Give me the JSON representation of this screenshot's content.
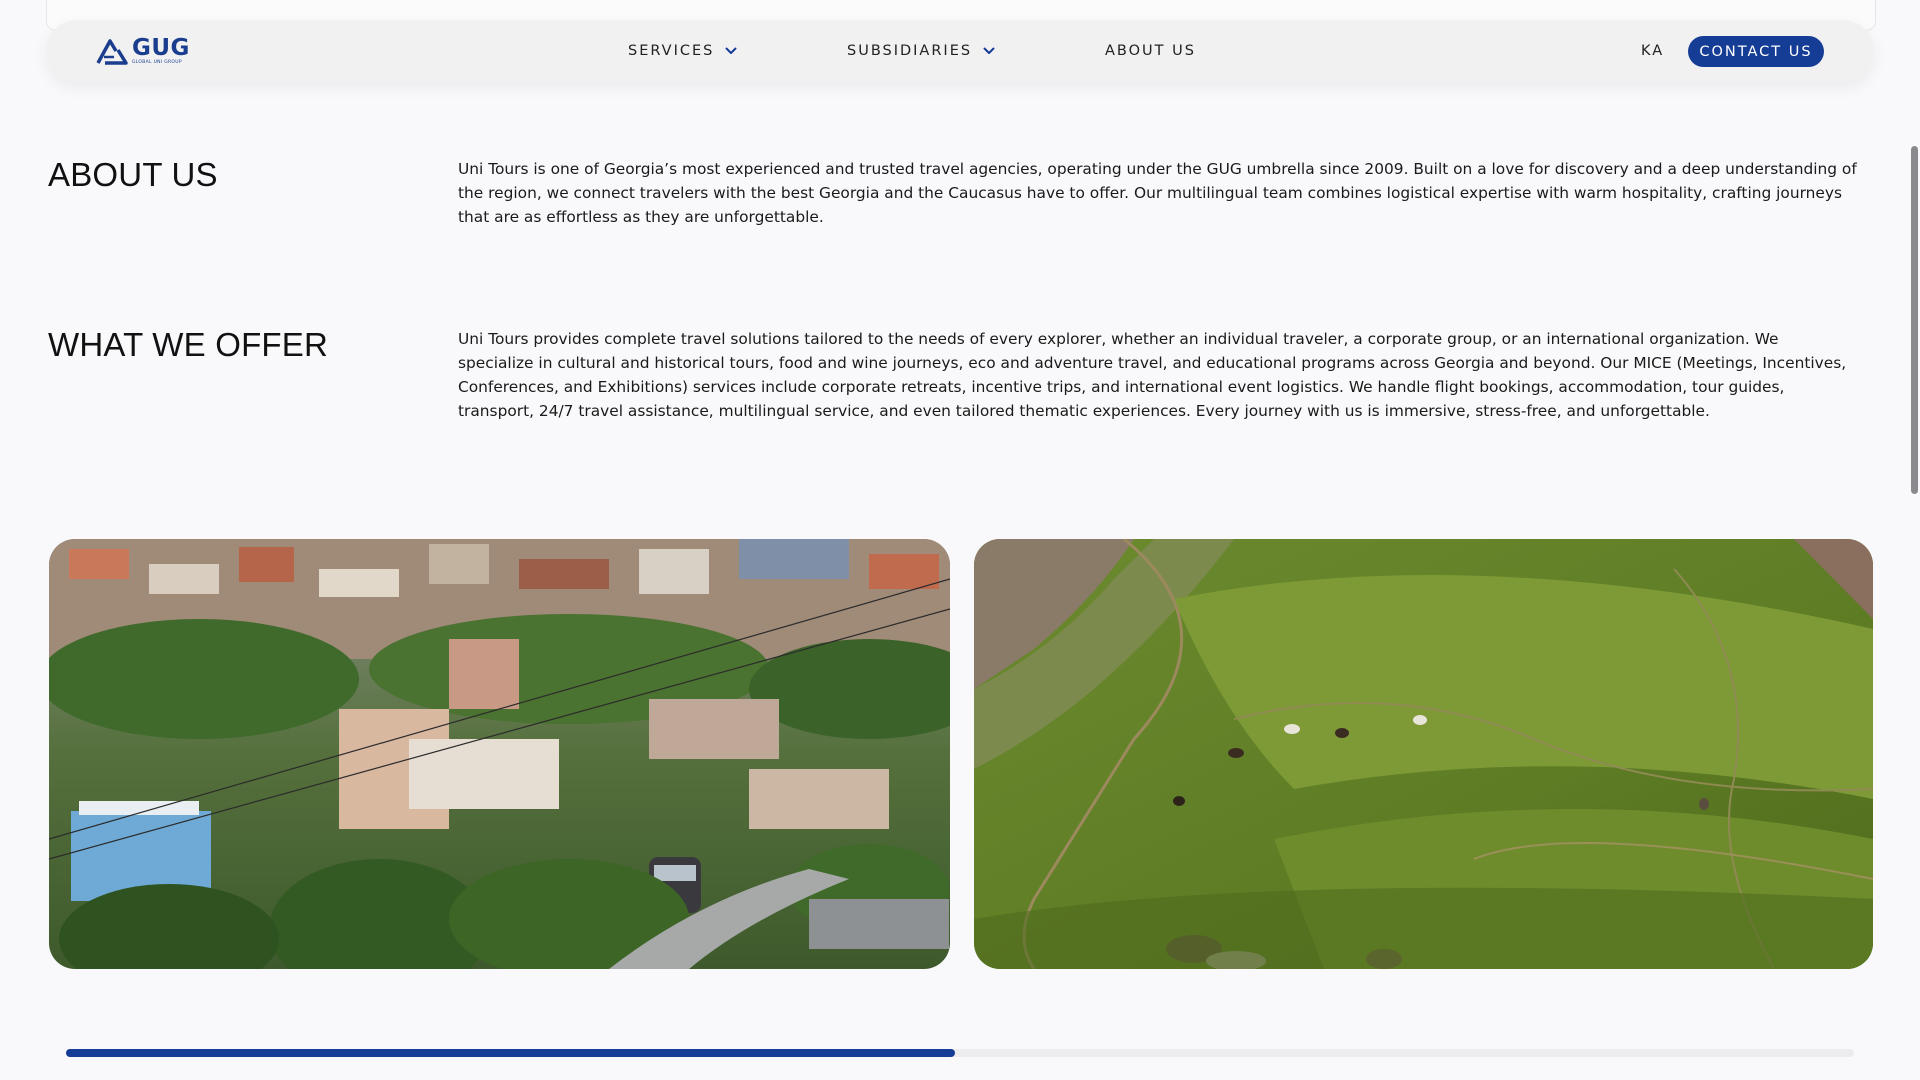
{
  "nav": {
    "logo_text": "GUG",
    "logo_subtext": "GLOBAL UNI GROUP",
    "services_label": "SERVICES",
    "subsidiaries_label": "SUBSIDIARIES",
    "about_label": "ABOUT US",
    "language_label": "KA",
    "contact_label": "CONTACT US"
  },
  "about": {
    "title": "ABOUT US",
    "text": "Uni Tours is one of Georgia’s most experienced and trusted travel agencies, operating under the GUG umbrella since 2009. Built on a love for discovery and a deep understanding of the region, we connect travelers with the best Georgia and the Caucasus have to offer. Our multilingual team combines logistical expertise with warm hospitality, crafting journeys that are as effortless as they are unforgettable."
  },
  "offer": {
    "title": "WHAT WE OFFER",
    "text": "Uni Tours provides complete travel solutions tailored to the needs of every explorer, whether an individual traveler, a corporate group, or an international organization. We specialize in cultural and historical tours, food and wine journeys, eco and adventure travel, and educational programs across Georgia and beyond. Our MICE (Meetings, Incentives, Conferences, and Exhibitions) services include corporate retreats, incentive trips, and international event logistics. We handle flight bookings, accommodation, tour guides, transport, 24/7 travel assistance, multilingual service, and even tailored thematic experiences. Every journey with us is immersive, stress-free, and unforgettable."
  },
  "gallery": {
    "progress_fraction": 0.497
  },
  "colors": {
    "brand": "#153d96",
    "background": "#f9f9fb",
    "nav_background": "#f1f1f2"
  },
  "icons": {
    "services_dropdown": "chevron-down-icon",
    "subsidiaries_dropdown": "chevron-down-icon",
    "logo": "gug-logo-icon"
  }
}
